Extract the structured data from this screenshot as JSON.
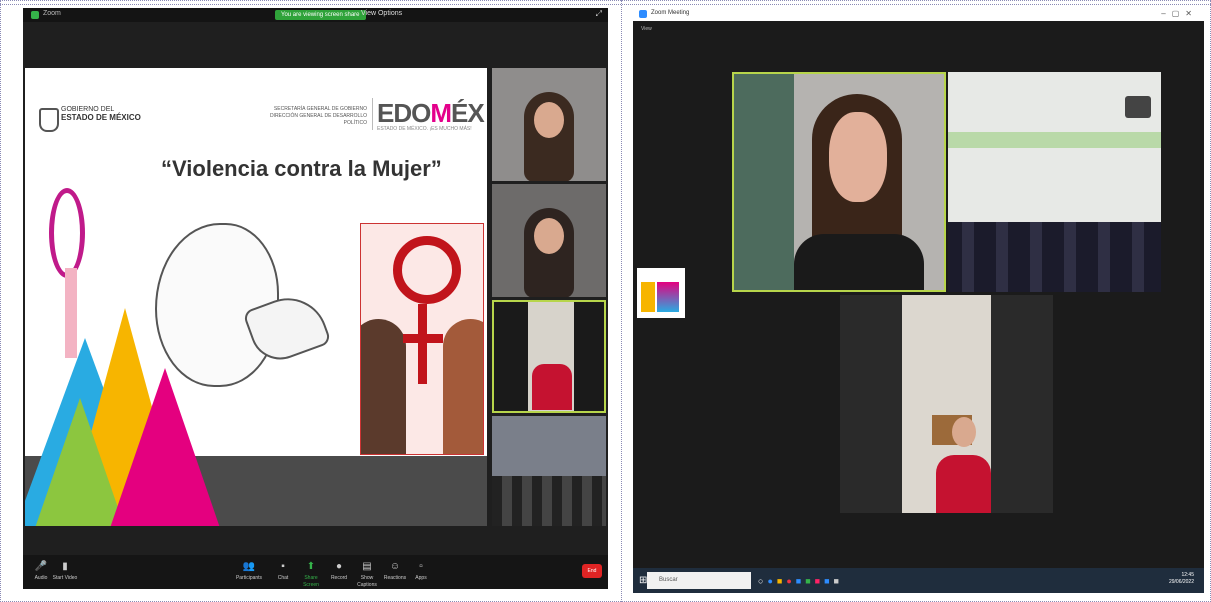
{
  "left_window": {
    "title": "Zoom",
    "share_banner": "You are viewing screen share",
    "view_label": "View Options",
    "slide": {
      "gov_line1": "GOBIERNO DEL",
      "gov_line2": "ESTADO DE MÉXICO",
      "secretaria_line1": "SECRETARÍA GENERAL DE GOBIERNO",
      "secretaria_line2": "DIRECCIÓN GENERAL DE DESARROLLO POLÍTICO",
      "brand_prefix": "EDO",
      "brand_mid": "M",
      "brand_suffix": "ÉX",
      "brand_sub": "ESTADO DE MÉXICO. ¡ES MUCHO MÁS!",
      "title": "“Violencia contra la Mujer”"
    },
    "toolbar": [
      {
        "icon": "mic-icon",
        "glyph": "🎤",
        "label": "Audio"
      },
      {
        "icon": "video-icon",
        "glyph": "▮",
        "label": "Start Video"
      },
      {
        "icon": "participants-icon",
        "glyph": "👥",
        "label": "Participants"
      },
      {
        "icon": "chat-icon",
        "glyph": "▪",
        "label": "Chat"
      },
      {
        "icon": "share-screen-icon",
        "glyph": "⬆",
        "label": "Share Screen"
      },
      {
        "icon": "record-icon",
        "glyph": "●",
        "label": "Record"
      },
      {
        "icon": "captions-icon",
        "glyph": "▤",
        "label": "Show Captions"
      },
      {
        "icon": "reactions-icon",
        "glyph": "☺",
        "label": "Reactions"
      },
      {
        "icon": "apps-icon",
        "glyph": "▫",
        "label": "Apps"
      }
    ],
    "end_label": "End"
  },
  "right_window": {
    "title": "Zoom Meeting",
    "sub": "View",
    "taskbar": {
      "search_placeholder": "Buscar",
      "time": "12:45",
      "date": "29/06/2022"
    }
  }
}
